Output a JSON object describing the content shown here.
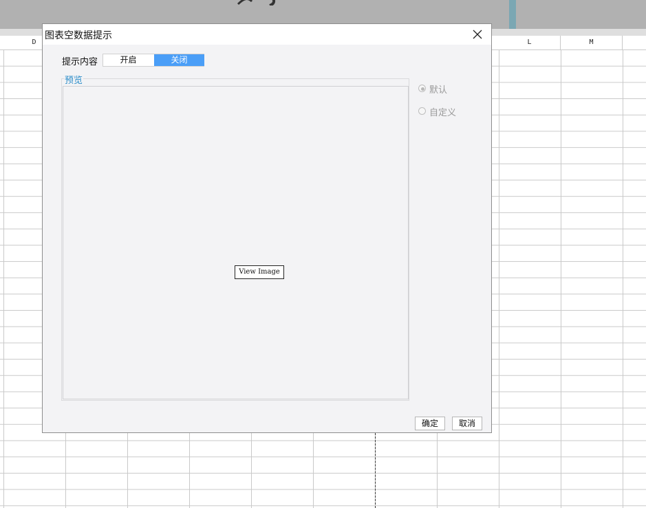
{
  "spreadsheet": {
    "columns": [
      {
        "label": "D"
      },
      {
        "label": "L"
      },
      {
        "label": "M"
      }
    ]
  },
  "dialog": {
    "title": "图表空数据提示",
    "tip_label": "提示内容",
    "toggle": {
      "on_label": "开启",
      "off_label": "关闭",
      "selected": "关闭"
    },
    "preview": {
      "legend": "预览",
      "image_button": "View Image"
    },
    "options": [
      {
        "label": "默认",
        "checked": true,
        "enabled": false
      },
      {
        "label": "自定义",
        "checked": false,
        "enabled": false
      }
    ],
    "ok_label": "确定",
    "cancel_label": "取消"
  },
  "colors": {
    "accent": "#4a9ef7",
    "legend_text": "#2a8cc9",
    "dialog_bg": "#f3f3f5"
  }
}
